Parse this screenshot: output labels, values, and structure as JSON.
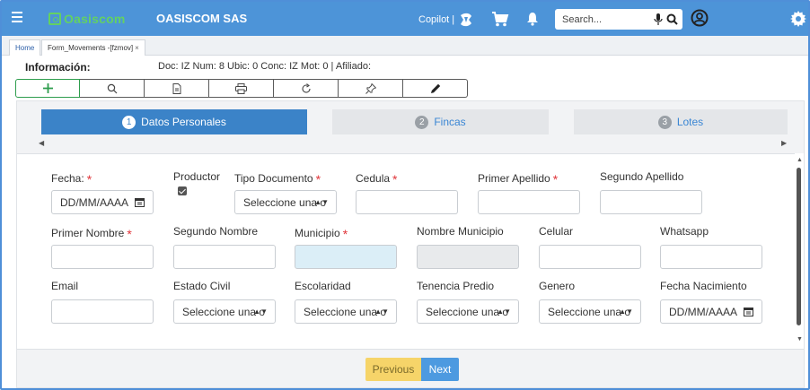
{
  "topbar": {
    "logo_text": "Oasiscom",
    "company": "OASISCOM SAS",
    "copilot_label": "Copilot |",
    "search_placeholder": "Search...",
    "bg_color": "#4d94d8",
    "logo_color": "#63d163",
    "icons": [
      "menu-icon",
      "copilot-icon",
      "cart-icon",
      "bell-icon",
      "mic-icon",
      "search-icon",
      "user-icon",
      "gear-icon"
    ]
  },
  "tabs": [
    {
      "label": "Home"
    },
    {
      "label": "Form_Movements -[fzmov]",
      "close": "×"
    }
  ],
  "info": {
    "title": "Información:",
    "doc": "Doc: IZ Num: 8 Ubic: 0 Conc: IZ Mot: 0 | Afiliado:"
  },
  "toolbar": {
    "buttons": [
      "add-icon",
      "search-icon",
      "document-icon",
      "print-icon",
      "refresh-icon",
      "pin-icon",
      "pencil-icon"
    ],
    "add_color": "#2e9d4d"
  },
  "steps": [
    {
      "num": "1",
      "label": "Datos Personales",
      "active": true
    },
    {
      "num": "2",
      "label": "Fincas",
      "active": false
    },
    {
      "num": "3",
      "label": "Lotes",
      "active": false
    }
  ],
  "nav_arrows": {
    "left": "◀",
    "right": "▶",
    "up": "▲",
    "down": "▼"
  },
  "form": {
    "row1": {
      "fecha": {
        "label": "Fecha:",
        "required": "*",
        "placeholder": "DD/MM/AAAA"
      },
      "productor": {
        "label": "Productor",
        "checked": true
      },
      "tipo_documento": {
        "label": "Tipo Documento",
        "required": "*",
        "value": "Seleccione una o"
      },
      "cedula": {
        "label": "Cedula",
        "required": "*",
        "value": ""
      },
      "primer_apellido": {
        "label": "Primer Apellido",
        "required": "*",
        "value": ""
      },
      "segundo_apellido": {
        "label": "Segundo Apellido",
        "value": ""
      }
    },
    "row2": {
      "primer_nombre": {
        "label": "Primer Nombre",
        "required": "*",
        "value": ""
      },
      "segundo_nombre": {
        "label": "Segundo Nombre",
        "value": ""
      },
      "municipio": {
        "label": "Municipio",
        "required": "*",
        "value": ""
      },
      "nombre_municipio": {
        "label": "Nombre Municipio",
        "value": ""
      },
      "celular": {
        "label": "Celular",
        "value": ""
      },
      "whatsapp": {
        "label": "Whatsapp",
        "value": ""
      }
    },
    "row3": {
      "email": {
        "label": "Email",
        "value": ""
      },
      "estado_civil": {
        "label": "Estado Civil",
        "value": "Seleccione una o"
      },
      "escolaridad": {
        "label": "Escolaridad",
        "value": "Seleccione una o"
      },
      "tenencia_predio": {
        "label": "Tenencia Predio",
        "value": "Seleccione una o"
      },
      "genero": {
        "label": "Genero",
        "value": "Seleccione una o"
      },
      "fecha_nacimiento": {
        "label": "Fecha Nacimiento",
        "placeholder": "DD/MM/AAAA"
      }
    }
  },
  "footer": {
    "previous": "Previous",
    "next": "Next"
  }
}
